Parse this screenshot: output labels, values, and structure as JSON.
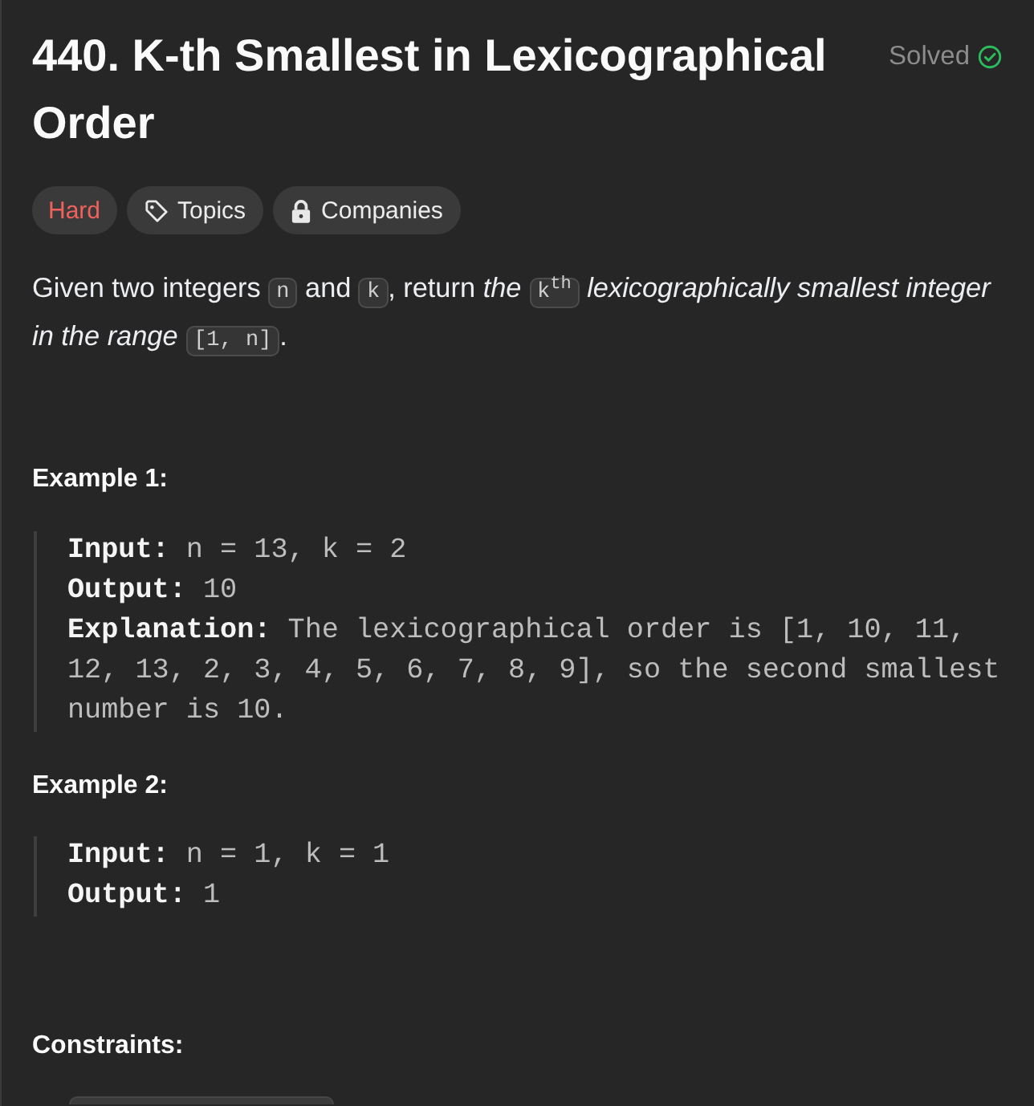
{
  "title": "440. K-th Smallest in Lexicographical Order",
  "status": {
    "label": "Solved",
    "solved": true
  },
  "badges": [
    {
      "kind": "difficulty",
      "label": "Hard"
    },
    {
      "kind": "topics",
      "label": "Topics"
    },
    {
      "kind": "companies",
      "label": "Companies"
    }
  ],
  "description": [
    {
      "kind": "text",
      "text": "Given two integers "
    },
    {
      "kind": "code",
      "text": "n"
    },
    {
      "kind": "text",
      "text": " and "
    },
    {
      "kind": "code",
      "text": "k"
    },
    {
      "kind": "text",
      "text": ", return *the* "
    },
    {
      "kind": "code",
      "text": "k$^{th}$"
    },
    {
      "kind": "text",
      "text": " *lexicographically smallest integer in the range* "
    },
    {
      "kind": "code",
      "text": "[1, n]"
    },
    {
      "kind": "text",
      "text": "."
    }
  ],
  "examples": [
    {
      "title": "Example 1:",
      "lines": [
        {
          "label": "Input:",
          "value": "n = 13, k = 2"
        },
        {
          "label": "Output:",
          "value": "10"
        },
        {
          "label": "Explanation:",
          "value": "The lexicographical order is [1, 10, 11, 12, 13, 2, 3, 4, 5, 6, 7, 8, 9], so the second smallest number is 10."
        }
      ]
    },
    {
      "title": "Example 2:",
      "lines": [
        {
          "label": "Input:",
          "value": "n = 1, k = 1"
        },
        {
          "label": "Output:",
          "value": "1"
        }
      ]
    }
  ],
  "constraints": {
    "title": "Constraints:"
  }
}
